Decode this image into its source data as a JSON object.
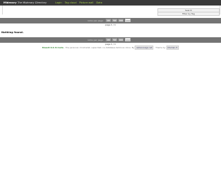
{
  "header": {
    "site_name": "Midenary",
    "site_tagline": "The Midenary Directory",
    "nav": [
      "Login",
      "Tag cloud",
      "Picture wall",
      "Data"
    ]
  },
  "search": {
    "search_label": "Search",
    "filter_label": "Filter by Tag"
  },
  "pager": {
    "per_page_label": "Links per page:",
    "per_page_options": [
      "20",
      "50",
      "100",
      "200"
    ],
    "selected_option": "200",
    "page_indicator": "page 1 / 1"
  },
  "content": {
    "empty_message": "Nothing found."
  },
  "footer": {
    "brand": "Shaarli 0.0.41 beta",
    "text": " - The personal, minimalist, super-fast, no-database delicious clone. By",
    "author_link": "sebsauvage.net",
    "theme_text": ". Theme by",
    "theme_link": "idleman.fr"
  },
  "colors": {
    "topbar": "#3a3a3a",
    "pager_bar": "#747474",
    "nav_link": "#a9d14a",
    "brand": "#3b8a3b"
  }
}
